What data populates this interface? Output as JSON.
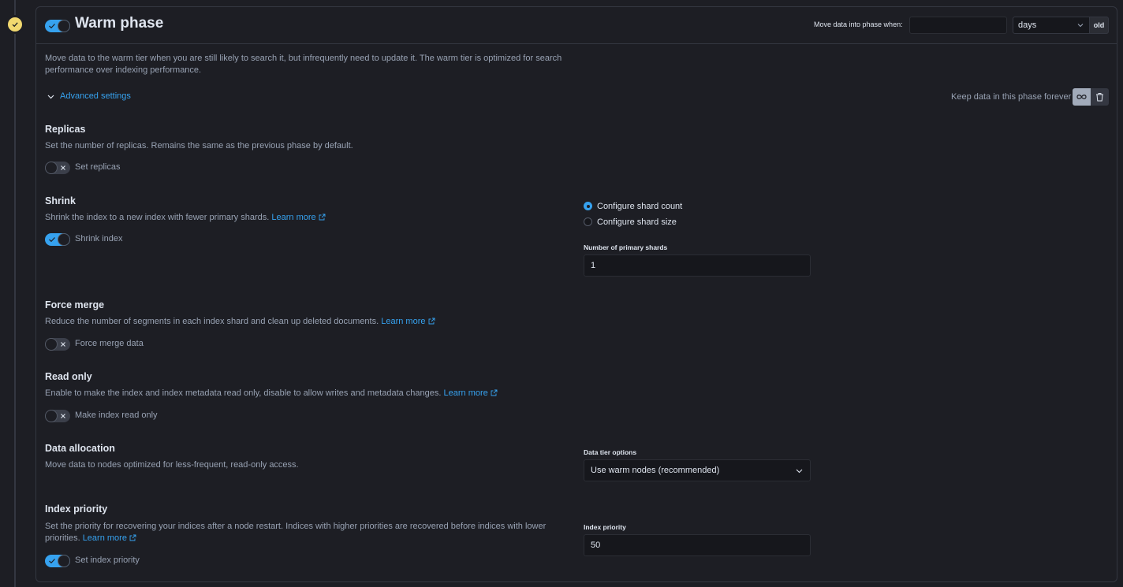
{
  "phase": {
    "title": "Warm phase",
    "enabled": true,
    "status_icon": "check-icon",
    "description": "Move data to the warm tier when you are still likely to search it, but infrequently need to update it. The warm tier is optimized for search performance over indexing performance.",
    "advanced_settings_label": "Advanced settings"
  },
  "timing": {
    "label": "Move data into phase when:",
    "age_value": "",
    "unit_selected": "days",
    "append_label": "old"
  },
  "keep_forever": {
    "label": "Keep data in this phase forever",
    "buttons": [
      {
        "icon": "infinity-icon",
        "selected": true
      },
      {
        "icon": "trash-icon",
        "selected": false
      }
    ]
  },
  "sections": {
    "replicas": {
      "title": "Replicas",
      "description": "Set the number of replicas. Remains the same as the previous phase by default.",
      "switch_label": "Set replicas",
      "enabled": false
    },
    "shrink": {
      "title": "Shrink",
      "description": "Shrink the index to a new index with fewer primary shards.",
      "link": "Learn more",
      "switch_label": "Shrink index",
      "enabled": true,
      "radios": [
        {
          "label": "Configure shard count",
          "checked": true
        },
        {
          "label": "Configure shard size",
          "checked": false
        }
      ],
      "field_label": "Number of primary shards",
      "field_value": "1"
    },
    "force_merge": {
      "title": "Force merge",
      "description": "Reduce the number of segments in each index shard and clean up deleted documents.",
      "link": "Learn more",
      "switch_label": "Force merge data",
      "enabled": false
    },
    "read_only": {
      "title": "Read only",
      "description": "Enable to make the index and index metadata read only, disable to allow writes and metadata changes.",
      "link": "Learn more",
      "switch_label": "Make index read only",
      "enabled": false
    },
    "data_allocation": {
      "title": "Data allocation",
      "description": "Move data to nodes optimized for less-frequent, read-only access.",
      "field_label": "Data tier options",
      "selected": "Use warm nodes (recommended)"
    },
    "index_priority": {
      "title": "Index priority",
      "description_line1": "Set the priority for recovering your indices after a node restart. Indices with higher priorities are recovered before indices with lower",
      "description_line2": "priorities.",
      "link": "Learn more",
      "switch_label": "Set index priority",
      "enabled": true,
      "field_label": "Index priority",
      "field_value": "50"
    }
  },
  "colors": {
    "accent": "#36a2ef",
    "phase_badge": "#f1d86f",
    "background": "#1d1e24"
  }
}
